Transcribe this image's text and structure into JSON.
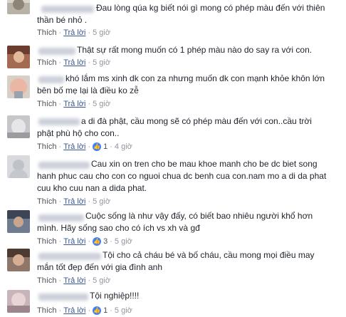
{
  "comments": [
    {
      "text": "Đau lòng qúa kg biết nói gì mong có phép màu đến với thiên\nthần bé nhỏ .",
      "action_like": "Thích",
      "action_reply": "Trả lời",
      "time": "5 giờ",
      "likes": ""
    },
    {
      "text": "Thật sự rất mong muốn có 1 phép màu nào do say ra với con.",
      "action_like": "Thích",
      "action_reply": "Trả lời",
      "time": "5 giờ",
      "likes": ""
    },
    {
      "text": "khó lắm ms xinh dk con za nhưng muốn dk con mạnh khỏe khôn lớn\nbên bố mẹ lại là điều ko zễ",
      "action_like": "Thích",
      "action_reply": "Trả lời",
      "time": "5 giờ",
      "likes": ""
    },
    {
      "text": "a di đà phật, cầu mong sẽ có phép màu đến với con..cầu trời\nphật phù hộ cho con..",
      "action_like": "Thích",
      "action_reply": "Trả lời",
      "time": "4 giờ",
      "likes": "1"
    },
    {
      "text": "Cau xin on tren cho be mau khoe manh cho be dc biet song\nhanh phuc cau cho con co nguoi chua dc benh cua con.nam mo a di da phat\ncuu kho cuu nan a dida phat.",
      "action_like": "Thích",
      "action_reply": "Trả lời",
      "time": "5 giờ",
      "likes": ""
    },
    {
      "text": "Cuộc sống là như vậy đấy, có biết bao nhiêu người khổ hơn\nmình. Hãy sống sao cho có ích vs xh và gđ",
      "action_like": "Thích",
      "action_reply": "Trả lời",
      "time": "5 giờ",
      "likes": "3"
    },
    {
      "text": "Tội cho cả cháu bé và bố cháu, cầu mong mọi điều may\nmắn tốt đẹp đến với gia đình anh",
      "action_like": "Thích",
      "action_reply": "Trả lời",
      "time": "5 giờ",
      "likes": ""
    },
    {
      "text": "Tội nghiệp!!!!",
      "action_like": "Thích",
      "action_reply": "Trả lời",
      "time": "5 giờ",
      "likes": "1"
    }
  ],
  "colors": {
    "reply_link": "#385898",
    "meta_gray": "#90949c",
    "like_badge": "#4080ff"
  },
  "icons": {
    "like_badge": "thumbs-up-icon"
  }
}
